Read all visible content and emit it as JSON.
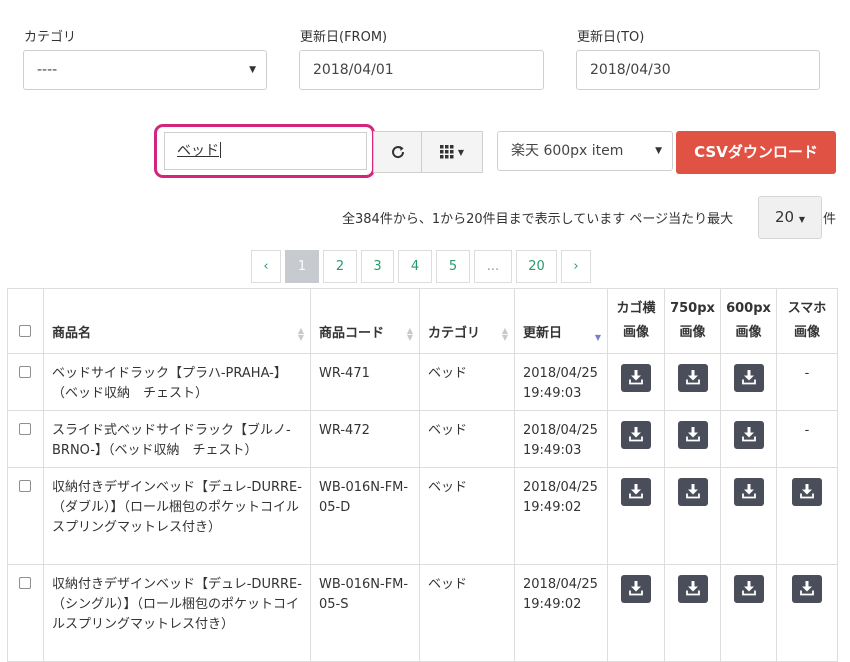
{
  "filters": {
    "category_label": "カテゴリ",
    "category_value": "----",
    "date_from_label": "更新日(FROM)",
    "date_from_value": "2018/04/01",
    "date_to_label": "更新日(TO)",
    "date_to_value": "2018/04/30"
  },
  "toolbar": {
    "search_value": "ベッド",
    "format_value": "楽天 600px item",
    "csv_label": "CSVダウンロード"
  },
  "summary": {
    "text": "全384件から、1から20件目まで表示しています ページ当たり最大",
    "per_page": "20",
    "unit": "件"
  },
  "pagination": {
    "prev": "‹",
    "pages": [
      "1",
      "2",
      "3",
      "4",
      "5",
      "...",
      "20"
    ],
    "next": "›",
    "active": "1"
  },
  "table": {
    "headers": {
      "name": "商品名",
      "code": "商品コード",
      "category": "カテゴリ",
      "updated": "更新日",
      "cago_1": "カゴ横",
      "cago_2": "画像",
      "px750_1": "750px",
      "px750_2": "画像",
      "px600_1": "600px",
      "px600_2": "画像",
      "smaho_1": "スマホ",
      "smaho_2": "画像"
    },
    "rows": [
      {
        "name": "ベッドサイドラック【プラハ-PRAHA-】（ベッド収納　チェスト）",
        "code": "WR-471",
        "category": "ベッド",
        "date": "2018/04/25",
        "time": "19:49:03",
        "smartphone": "-"
      },
      {
        "name": "スライド式ベッドサイドラック【ブルノ-BRNO-】（ベッド収納　チェスト）",
        "code": "WR-472",
        "category": "ベッド",
        "date": "2018/04/25",
        "time": "19:49:03",
        "smartphone": "-"
      },
      {
        "name": "収納付きデザインベッド【デュレ-DURRE-（ダブル）】（ロール梱包のポケットコイルスプリングマットレス付き）",
        "code": "WB-016N-FM-05-D",
        "category": "ベッド",
        "date": "2018/04/25",
        "time": "19:49:02",
        "smartphone": "download"
      },
      {
        "name": "収納付きデザインベッド【デュレ-DURRE-（シングル）】（ロール梱包のポケットコイルスプリングマットレス付き）",
        "code": "WB-016N-FM-05-S",
        "category": "ベッド",
        "date": "2018/04/25",
        "time": "19:49:02",
        "smartphone": "download"
      }
    ]
  },
  "icons": {
    "refresh": "refresh-icon",
    "columns": "grid-icon",
    "download": "download-icon"
  },
  "colors": {
    "accent_danger": "#e05243",
    "highlight_ring": "#d5247c",
    "link_green": "#2a9a6a",
    "download_button": "#4a4d5a"
  }
}
